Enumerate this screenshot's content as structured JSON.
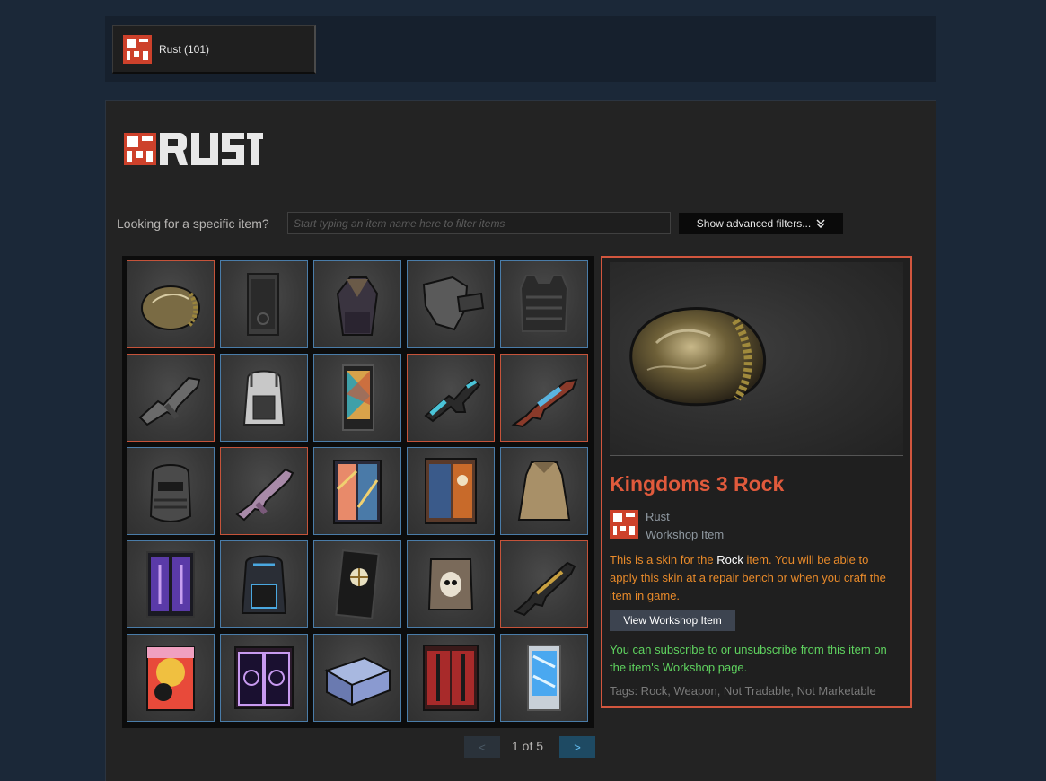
{
  "games_bar": {
    "tabs": [
      {
        "label": "Rust (101)"
      }
    ]
  },
  "filter": {
    "label": "Looking for a specific item?",
    "placeholder": "Start typing an item name here to filter items",
    "advanced_label": "Show advanced filters..."
  },
  "inventory": {
    "items": [
      {
        "icon": "rock-icon",
        "rare": true
      },
      {
        "icon": "locker-icon",
        "rare": false
      },
      {
        "icon": "hoodie-icon",
        "rare": false
      },
      {
        "icon": "armor-plate-icon",
        "rare": false
      },
      {
        "icon": "chest-plate-icon",
        "rare": false
      },
      {
        "icon": "smg-icon",
        "rare": true
      },
      {
        "icon": "backpack-icon",
        "rare": false
      },
      {
        "icon": "vending-locker-icon",
        "rare": false
      },
      {
        "icon": "pistol-icon",
        "rare": true
      },
      {
        "icon": "rifle-icon",
        "rare": true
      },
      {
        "icon": "facemask-icon",
        "rare": false
      },
      {
        "icon": "purple-rifle-icon",
        "rare": true
      },
      {
        "icon": "wardrobe-icon",
        "rare": false
      },
      {
        "icon": "tall-cabinet-icon",
        "rare": false
      },
      {
        "icon": "poncho-icon",
        "rare": false
      },
      {
        "icon": "purple-wardrobe-icon",
        "rare": false
      },
      {
        "icon": "blue-backpack-icon",
        "rare": false
      },
      {
        "icon": "door-icon",
        "rare": false
      },
      {
        "icon": "skull-vest-icon",
        "rare": false
      },
      {
        "icon": "gold-rifle-icon",
        "rare": true
      },
      {
        "icon": "anime-box-icon",
        "rare": false
      },
      {
        "icon": "neon-doors-icon",
        "rare": false
      },
      {
        "icon": "storage-box-icon",
        "rare": false
      },
      {
        "icon": "red-cabinet-icon",
        "rare": false
      },
      {
        "icon": "ice-locker-icon",
        "rare": false
      }
    ]
  },
  "pager": {
    "prev": "<",
    "text": "1 of 5",
    "next": ">"
  },
  "details": {
    "title": "Kingdoms 3 Rock",
    "game": "Rust",
    "type": "Workshop Item",
    "desc_1": "This is a skin for the ",
    "desc_item": "Rock",
    "desc_2": " item. You will be able to apply this skin at a repair bench or when you craft the item in game.",
    "view_button": "View Workshop Item",
    "subscribe_note": "You can subscribe to or unsubscribe from this item on the item's Workshop page.",
    "tags": "Tags: Rock, Weapon, Not Tradable, Not Marketable"
  },
  "colors": {
    "background": "#1b2838",
    "rare_border": "#c5533a",
    "common_border": "#4a7ca8",
    "title": "#e05a3c",
    "description": "#e88a2a",
    "subscribe_note": "#5fd35f"
  }
}
